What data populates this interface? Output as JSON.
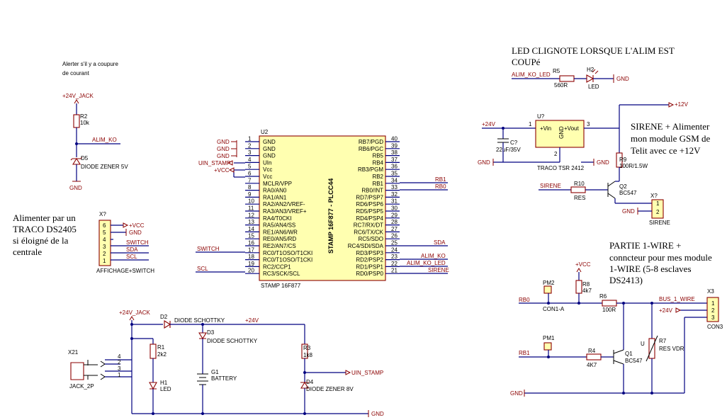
{
  "notes": {
    "alerter_1": "Alerter s'il y a coupure",
    "alerter_2": "de courant",
    "alimenter_1": "Alimenter par un",
    "alimenter_2": "TRACO DS2405",
    "alimenter_3": "si éloigné de la",
    "alimenter_4": "centrale",
    "led_1": "LED CLIGNOTE LORSQUE L'ALIM EST",
    "led_2": "COUPé",
    "sirene_1": "SIRENE + Alimenter",
    "sirene_2": "mon module GSM de",
    "sirene_3": "Telit avec ce +12V",
    "onewire_1": "PARTIE 1-WIRE +",
    "onewire_2": "conncteur pour mes module",
    "onewire_3": "1-WIRE (5-8 esclaves",
    "onewire_4": "DS2413)"
  },
  "u2": {
    "ref": "U2",
    "name": "STAMP 16F877 - PLCC44",
    "footer": "STAMP 16F877",
    "left_pins": [
      {
        "num": "1",
        "name": "GND"
      },
      {
        "num": "2",
        "name": "GND"
      },
      {
        "num": "3",
        "name": "GND"
      },
      {
        "num": "4",
        "name": "UIn"
      },
      {
        "num": "5",
        "name": "Vcc"
      },
      {
        "num": "6",
        "name": "Vcc"
      },
      {
        "num": "7",
        "name": "MCLR/VPP"
      },
      {
        "num": "8",
        "name": "RA0/AN0"
      },
      {
        "num": "9",
        "name": "RA1/AN1"
      },
      {
        "num": "10",
        "name": "RA2/AN2/VREF-"
      },
      {
        "num": "11",
        "name": "RA3/AN3/VREF+"
      },
      {
        "num": "12",
        "name": "RA4/T0CKI"
      },
      {
        "num": "13",
        "name": "RA5/AN4/SS"
      },
      {
        "num": "14",
        "name": "RE1/AN6/WR"
      },
      {
        "num": "15",
        "name": "RE0/AN5/RD"
      },
      {
        "num": "16",
        "name": "RE2/AN7/CS"
      },
      {
        "num": "17",
        "name": "RC0/T1OSO/T1CKI"
      },
      {
        "num": "18",
        "name": "RC0/T1OSO/T1CKI"
      },
      {
        "num": "19",
        "name": "RC2/CCP1"
      },
      {
        "num": "20",
        "name": "RC3/SCK/SCL"
      }
    ],
    "right_pins": [
      {
        "num": "40",
        "name": "RB7/PGD"
      },
      {
        "num": "39",
        "name": "RB6/PGC"
      },
      {
        "num": "38",
        "name": "RB5"
      },
      {
        "num": "37",
        "name": "RB4"
      },
      {
        "num": "36",
        "name": "RB3/PGM"
      },
      {
        "num": "35",
        "name": "RB2"
      },
      {
        "num": "34",
        "name": "RB1"
      },
      {
        "num": "33",
        "name": "RB0/INT"
      },
      {
        "num": "32",
        "name": "RD7/PSP7"
      },
      {
        "num": "31",
        "name": "RD6/PSP6"
      },
      {
        "num": "30",
        "name": "RD5/PSP5"
      },
      {
        "num": "29",
        "name": "RD4/PSP4"
      },
      {
        "num": "28",
        "name": "RC7/RX/DT"
      },
      {
        "num": "27",
        "name": "RC6/TX/CK"
      },
      {
        "num": "26",
        "name": "RC5/SDO"
      },
      {
        "num": "25",
        "name": "RC4/SDI/SDA"
      },
      {
        "num": "24",
        "name": "RD3/PSP3"
      },
      {
        "num": "23",
        "name": "RD2/PSP2"
      },
      {
        "num": "22",
        "name": "RD1/PSP1"
      },
      {
        "num": "21",
        "name": "RD0/PSP0"
      }
    ],
    "left_nets": {
      "gnd1": "GND",
      "gnd2": "GND",
      "gnd3": "GND",
      "uin": "UIN_STAMP",
      "vcc": "+VCC",
      "switch": "SWITCH",
      "scl": "SCL"
    },
    "right_nets": {
      "rb1": "RB1",
      "rb0": "RB0",
      "sda": "SDA",
      "alim_ko": "ALIM_KO",
      "alim_ko_led": "ALIM_KO_LED",
      "sirene": "SIRENE"
    }
  },
  "alerter": {
    "net_top": "+24V_JACK",
    "r_ref": "R2",
    "r_val": "10k",
    "net_out": "ALIM_KO",
    "d_ref": "D5",
    "d_val": "DIODE ZENER 5V",
    "gnd": "GND"
  },
  "affichage": {
    "ref": "X?",
    "name": "AFFICHAGE+SWITCH",
    "pins": [
      "6",
      "5",
      "4",
      "3",
      "2",
      "1"
    ],
    "nets": [
      "+VCC",
      "GND",
      "SWITCH",
      "SDA",
      "SCL"
    ]
  },
  "led_circuit": {
    "net_in": "ALIM_KO_LED",
    "r_ref": "R5",
    "r_val": "560R",
    "led_ref": "H2",
    "led_val": "LED",
    "gnd": "GND"
  },
  "regulator": {
    "ref": "U?",
    "pin_vin": "+Vin",
    "pin_gnd": "GND",
    "pin_vout": "+Vout",
    "n1": "1",
    "n2": "2",
    "n3": "3",
    "name": "TRACO TSR 2412",
    "net_in": "+24V",
    "c_ref": "C?",
    "c_val": "22uF/35V",
    "gnd1": "GND",
    "gnd2": "GND",
    "net_out": "+12V"
  },
  "sirene_circuit": {
    "r9_ref": "R9",
    "r9_val": "100R/1.5W",
    "q_ref": "Q2",
    "q_val": "BC547",
    "r10_ref": "R10",
    "r10_val": "RES",
    "net": "SIRENE",
    "conn_ref": "X?",
    "conn_name": "SIRENE",
    "p1": "1",
    "p2": "2",
    "gnd": "GND"
  },
  "onewire": {
    "vcc": "+VCC",
    "pm2": "PM2",
    "pm1": "PM1",
    "r8_ref": "R8",
    "r8_val": "4k7",
    "r6_ref": "R6",
    "r6_val": "100R",
    "con": "CON1-A",
    "rb0": "RB0",
    "rb1": "RB1",
    "r4_ref": "R4",
    "r4_val": "4K7",
    "q_ref": "Q1",
    "q_val": "BC547",
    "r7_ref": "R7",
    "r7_val": "RES VDR",
    "u": "U",
    "bus": "BUS_1_WIRE",
    "p24": "+24V",
    "x3": "X3",
    "x3_name": "CON3",
    "p1": "1",
    "p2": "2",
    "p3": "3",
    "gnd": "GND"
  },
  "power": {
    "net_jack": "+24V_JACK",
    "d2_ref": "D2",
    "d2_val": "DIODE SCHOTTKY",
    "net_24": "+24V",
    "d3_ref": "D3",
    "d3_val": "DIODE SCHOTTKY",
    "r1_ref": "R1",
    "r1_val": "2k2",
    "h1_ref": "H1",
    "h1_val": "LED",
    "g1_ref": "G1",
    "g1_val": "BATTERY",
    "r3_ref": "R3",
    "r3_val": "1k8",
    "d4_ref": "D4",
    "d4_val": "DIODE ZENER 8V",
    "uin": "UIN_STAMP",
    "jack_ref": "X21",
    "jack_name": "JACK_2P",
    "j4": "4",
    "j2": "2",
    "j3": "3",
    "j1": "1",
    "gnd": "GND"
  }
}
